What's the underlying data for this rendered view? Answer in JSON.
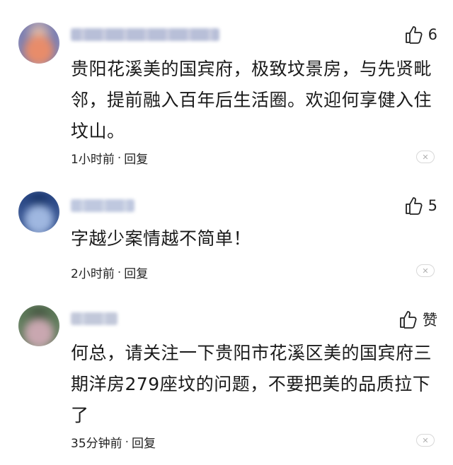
{
  "comments": [
    {
      "avatar_colors": [
        "#7b7fb2",
        "#e88c6a",
        "#f2c7a8"
      ],
      "username_colors": [
        "#b8bfd8",
        "#c9cde0"
      ],
      "likes": "6",
      "text": "贵阳花溪美的国宾府，极致坟景房，与先贤毗\n邻，提前融入百年后生活圈。欢迎何享健入住\n坟山。",
      "time": "1小时前",
      "sep": "·",
      "reply": "回复",
      "close": "✕"
    },
    {
      "avatar_colors": [
        "#2e4c8a",
        "#9fb7e0",
        "#0f2a5c"
      ],
      "username_colors": [
        "#bfc8df",
        "#cfd6e6"
      ],
      "likes": "5",
      "text": "字越少案情越不简单！",
      "time": "2小时前",
      "sep": "·",
      "reply": "回复",
      "close": "✕"
    },
    {
      "avatar_colors": [
        "#5e7a5a",
        "#c9a7b0",
        "#3e4d3a"
      ],
      "username_colors": [
        "#c2c8da",
        "#d1d6e4"
      ],
      "likes": "赞",
      "text": "何总，请关注一下贵阳市花溪区美的国宾府三\n期洋房279座坟的问题，不要把美的品质拉下\n了",
      "time": "35分钟前",
      "sep": "·",
      "reply": "回复",
      "close": "✕"
    }
  ]
}
